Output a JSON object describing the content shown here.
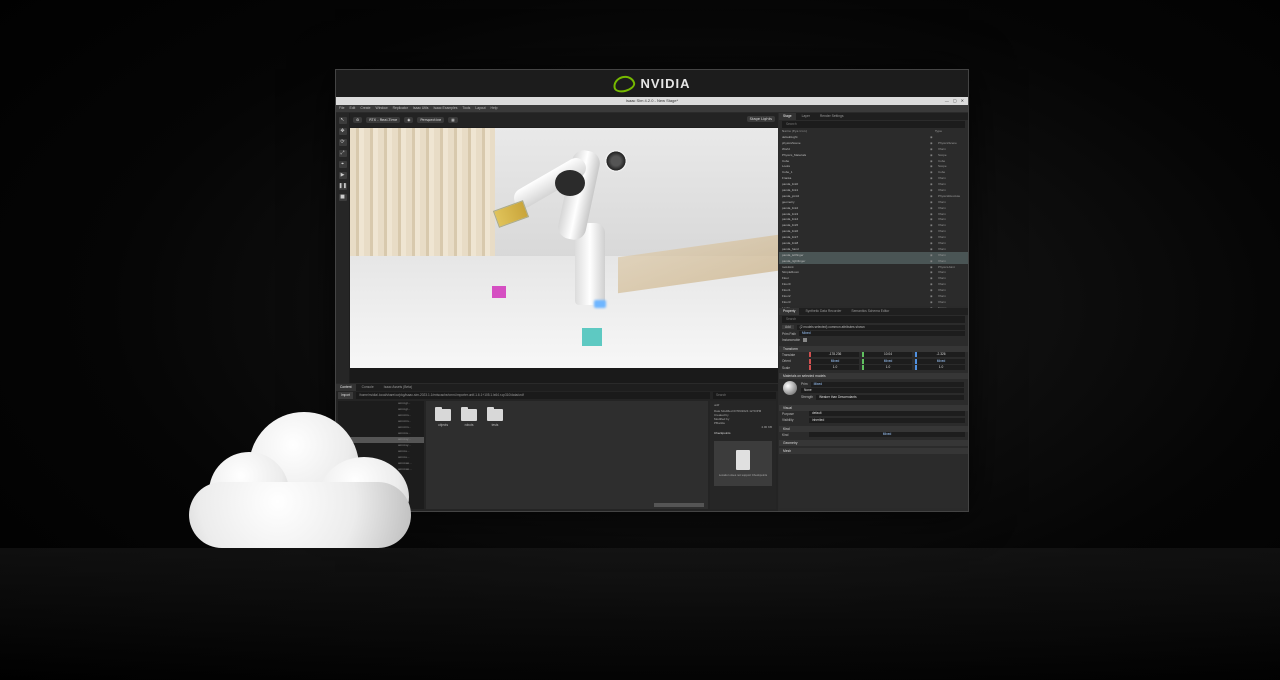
{
  "brand": {
    "name": "NVIDIA",
    "accent": "#76b900"
  },
  "window": {
    "title": "Isaac Sim 4.2.0 - New Stage*",
    "controls": [
      "—",
      "▢",
      "✕"
    ]
  },
  "menu": [
    "File",
    "Edit",
    "Create",
    "Window",
    "Replicator",
    "Isaac Utils",
    "Isaac Examples",
    "Tools",
    "Layout",
    "Help"
  ],
  "viewport": {
    "toolbar": {
      "rtx": "RTX - Real-Time",
      "camera": "Perspective",
      "lights": "Stage Lights"
    }
  },
  "stage": {
    "tabs": [
      "Stage",
      "Layer",
      "Render Settings"
    ],
    "search_placeholder": "Search",
    "columns": {
      "name": "Name (Eye Icon)",
      "type": "Type"
    },
    "rows": [
      {
        "name": "defaultLight",
        "type": ""
      },
      {
        "name": "physicsScene",
        "type": "PhysicsScene"
      },
      {
        "name": "World",
        "type": "Xform"
      },
      {
        "name": "Physics_Materials",
        "type": "Scope"
      },
      {
        "name": "Cube",
        "type": "Cube"
      },
      {
        "name": "Looks",
        "type": "Scope"
      },
      {
        "name": "Cube_1",
        "type": "Cube"
      },
      {
        "name": "Franka",
        "type": "Xform"
      },
      {
        "name": "panda_link0",
        "type": "Xform"
      },
      {
        "name": "panda_link1",
        "type": "Xform"
      },
      {
        "name": "panda_joint2",
        "type": "PhysicsRevolute"
      },
      {
        "name": "geometry",
        "type": "Xform"
      },
      {
        "name": "panda_link2",
        "type": "Xform"
      },
      {
        "name": "panda_link3",
        "type": "Xform"
      },
      {
        "name": "panda_link4",
        "type": "Xform"
      },
      {
        "name": "panda_link5",
        "type": "Xform"
      },
      {
        "name": "panda_link6",
        "type": "Xform"
      },
      {
        "name": "panda_link7",
        "type": "Xform"
      },
      {
        "name": "panda_link8",
        "type": "Xform"
      },
      {
        "name": "panda_hand",
        "type": "Xform"
      },
      {
        "name": "panda_leftfinger",
        "type": "Xform"
      },
      {
        "name": "panda_rightfinger",
        "type": "Xform"
      },
      {
        "name": "rootJoint",
        "type": "PhysicsJoint"
      },
      {
        "name": "SimpleRoom",
        "type": "Xform"
      },
      {
        "name": "Floor",
        "type": "Xform"
      },
      {
        "name": "Floor0",
        "type": "Xform"
      },
      {
        "name": "Floor1",
        "type": "Xform"
      },
      {
        "name": "Floor2",
        "type": "Xform"
      },
      {
        "name": "Floor3",
        "type": "Xform"
      },
      {
        "name": "Looks",
        "type": "Scope"
      }
    ]
  },
  "property": {
    "tabs": [
      "Property",
      "Synthetic Data Recorder",
      "Semantics Schema Editor"
    ],
    "search_placeholder": "Search",
    "add_label": "Add",
    "add_value": "(2 models selected) common attributes shown",
    "prim_path_label": "Prim Path",
    "prim_path_value": "Mixed",
    "instanceable_label": "Instanceable",
    "transform_head": "Transform",
    "translate_label": "Translate",
    "translate": [
      "-178.236",
      "10.04",
      "-2.326"
    ],
    "orient_label": "Orient",
    "orient": [
      "Mixed",
      "Mixed",
      "Mixed"
    ],
    "scale_label": "Scale",
    "scale": [
      "1.0",
      "1.0",
      "1.0"
    ],
    "materials_head": "Materials on selected models",
    "prim_label": "Prim",
    "prim_value": "Mixed",
    "material_value": "None",
    "strength_label": "Strength",
    "strength_value": "Weaker than Descendants",
    "visual_head": "Visual",
    "purpose_label": "Purpose",
    "purpose_value": "default",
    "visibility_label": "Visibility",
    "visibility_value": "inherited",
    "kind_head": "Kind",
    "kind_label": "Kind",
    "kind_value": "Mixed",
    "geometry_head": "Geometry",
    "mesh_head": "Mesh"
  },
  "content": {
    "tabs": [
      "Content",
      "Console",
      "Isaac Assets (Beta)"
    ],
    "import_label": "Import",
    "path": "/home/nvidia/.local/share/ov/pkg/isaac-sim-2023.1.1/extscache/omni.importer.urdf-1.6.1+105.1.lx64.r.cp310/data/urdf",
    "search_placeholder": "Search",
    "tree": [
      "omni.gr...",
      "omni.gr...",
      "omni.im...",
      "omni.im...",
      "omni.im...",
      "omni.re...",
      "omni.sy...",
      "omni.sy...",
      "omni.u...",
      "omni.u...",
      "omni.wo...",
      "omni.wo..."
    ],
    "folders": [
      "objects",
      "robots",
      "tests"
    ],
    "detail": {
      "name": "urdf",
      "modified": "Date Modified 07/09/2024 12:53PM",
      "created": "Created by",
      "modified_by": "Modified by",
      "user": "PBuckle",
      "size": "4.00 KB",
      "checkpoints": "Checkpoints",
      "note": "Location does not support Checkpoints"
    }
  }
}
